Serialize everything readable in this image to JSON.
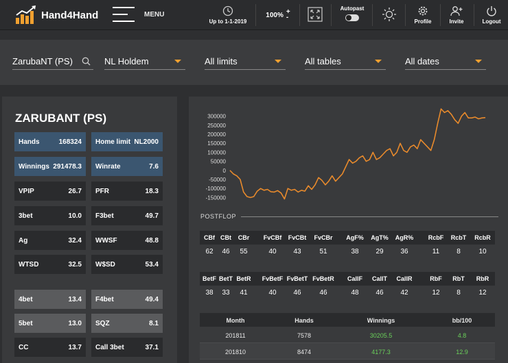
{
  "app": {
    "name": "Hand4Hand"
  },
  "topbar": {
    "menu_label": "MENU",
    "date_label": "Up to 1-1-2019",
    "zoom_label": "100%",
    "zoom_plus": "+",
    "zoom_minus": "-",
    "autopast_label": "Autopast",
    "profile_label": "Profile",
    "invite_label": "Invite",
    "logout_label": "Logout"
  },
  "filters": {
    "player": "ZarubaNT (PS)",
    "game": "NL Holdem",
    "limits": "All limits",
    "tables": "All tables",
    "dates": "All dates"
  },
  "player": {
    "title": "ZARUBANT (PS)",
    "stats": [
      {
        "label": "Hands",
        "value": "168324"
      },
      {
        "label": "Home limit",
        "value": "NL2000"
      },
      {
        "label": "Winnings",
        "value": "291478.3"
      },
      {
        "label": "Winrate",
        "value": "7.6"
      },
      {
        "label": "VPIP",
        "value": "26.7"
      },
      {
        "label": "PFR",
        "value": "18.3"
      },
      {
        "label": "3bet",
        "value": "10.0"
      },
      {
        "label": "F3bet",
        "value": "49.7"
      },
      {
        "label": "Ag",
        "value": "32.4"
      },
      {
        "label": "WWSF",
        "value": "48.8"
      },
      {
        "label": "WTSD",
        "value": "32.5"
      },
      {
        "label": "W$SD",
        "value": "53.4"
      },
      {
        "label": "4bet",
        "value": "13.4"
      },
      {
        "label": "F4bet",
        "value": "49.4"
      },
      {
        "label": "5bet",
        "value": "13.0"
      },
      {
        "label": "SQZ",
        "value": "8.1"
      },
      {
        "label": "CC",
        "value": "13.7"
      },
      {
        "label": "Call 3bet",
        "value": "37.1"
      }
    ]
  },
  "chart_data": {
    "type": "line",
    "yticks": [
      300000,
      250000,
      200000,
      150000,
      100000,
      50000,
      0,
      -50000,
      -100000,
      -150000
    ],
    "ylim": [
      -160000,
      340000
    ],
    "values": [
      0,
      -20000,
      -30000,
      -50000,
      -120000,
      -145000,
      -150000,
      -145000,
      -115000,
      -100000,
      -110000,
      -105000,
      -118000,
      -120000,
      -112000,
      -125000,
      -158000,
      -100000,
      -110000,
      -105000,
      -120000,
      -110000,
      -115000,
      -85000,
      -105000,
      -80000,
      -40000,
      -55000,
      -80000,
      -60000,
      -30000,
      -60000,
      -40000,
      -20000,
      20000,
      60000,
      40000,
      50000,
      70000,
      80000,
      50000,
      60000,
      100000,
      60000,
      70000,
      90000,
      110000,
      120000,
      80000,
      100000,
      150000,
      110000,
      100000,
      130000,
      140000,
      120000,
      170000,
      150000,
      130000,
      110000,
      170000,
      260000,
      340000,
      320000,
      330000,
      310000,
      280000,
      260000,
      300000,
      320000,
      290000,
      290000,
      295000,
      285000,
      290000,
      292000
    ]
  },
  "postflop": {
    "label": "POSTFLOP",
    "row1": {
      "headers": [
        "CBf",
        "CBt",
        "CBr",
        "FvCBf",
        "FvCBt",
        "FvCBr",
        "AgF%",
        "AgT%",
        "AgR%",
        "RcbF",
        "RcbT",
        "RcbR"
      ],
      "values": [
        "62",
        "46",
        "55",
        "40",
        "43",
        "51",
        "38",
        "29",
        "36",
        "11",
        "8",
        "10"
      ]
    },
    "row2": {
      "headers": [
        "BetF",
        "BetT",
        "BetR",
        "FvBetF",
        "FvBetT",
        "FvBetR",
        "CallF",
        "CallT",
        "CallR",
        "RbF",
        "RbT",
        "RbR"
      ],
      "values": [
        "38",
        "33",
        "41",
        "40",
        "46",
        "46",
        "48",
        "46",
        "42",
        "12",
        "8",
        "12"
      ]
    }
  },
  "monthly": {
    "headers": [
      "Month",
      "Hands",
      "Winnings",
      "bb/100"
    ],
    "rows": [
      [
        "201811",
        "7578",
        "30205.5",
        "4.8"
      ],
      [
        "201810",
        "8474",
        "4177.3",
        "12.9"
      ]
    ]
  },
  "colors": {
    "accent": "#f0a030",
    "chart_line": "#e88a2c",
    "positive": "#6ad05a"
  }
}
